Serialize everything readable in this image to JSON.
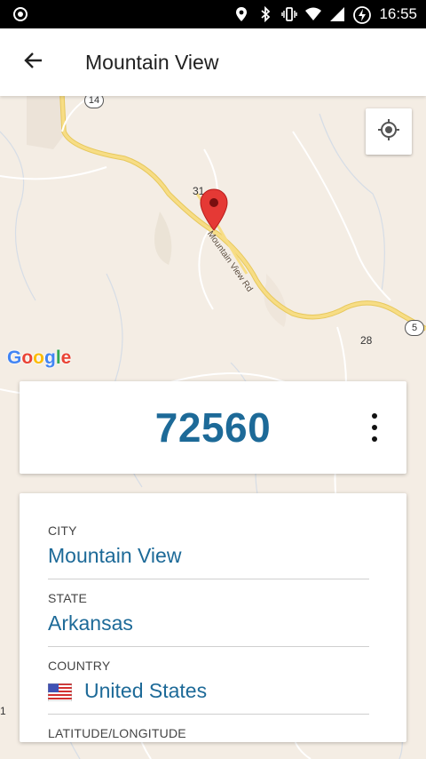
{
  "status_bar": {
    "time": "16:55",
    "icons": [
      "camera-icon",
      "location-icon",
      "bluetooth-icon",
      "vibrate-icon",
      "wifi-icon",
      "signal-icon",
      "battery-charging-icon"
    ]
  },
  "app_bar": {
    "title": "Mountain View",
    "back_icon": "arrow-back-icon"
  },
  "map": {
    "locate_icon": "my-location-icon",
    "road_label": "Mountain View Rd",
    "highway_14": "14",
    "highway_5": "5",
    "route_31": "31",
    "route_28": "28",
    "edge_number": "1",
    "google_logo": [
      "G",
      "o",
      "o",
      "g",
      "l",
      "e"
    ],
    "logo_colors": [
      "#4285F4",
      "#EA4335",
      "#FBBC05",
      "#4285F4",
      "#34A853",
      "#EA4335"
    ],
    "marker_color": "#E53935"
  },
  "zip_card": {
    "zip": "72560",
    "menu_icon": "more-vert-icon"
  },
  "info_card": {
    "city_label": "CITY",
    "city_value": "Mountain View",
    "state_label": "STATE",
    "state_value": "Arkansas",
    "country_label": "COUNTRY",
    "country_value": "United States",
    "country_flag_icon": "us-flag-icon",
    "latlong_label": "LATITUDE/LONGITUDE"
  },
  "colors": {
    "accent": "#1D6A98",
    "map_background": "#F4EDE4",
    "road_yellow": "#F3D677"
  }
}
